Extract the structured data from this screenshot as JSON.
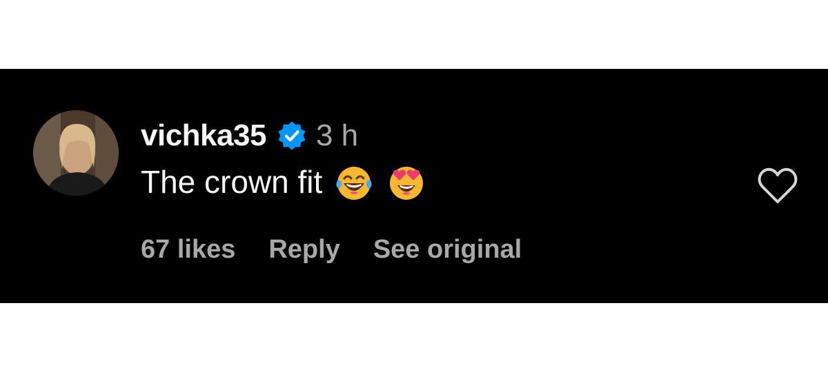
{
  "comment": {
    "username": "vichka35",
    "verified": true,
    "timestamp": "3 h",
    "text": "The crown fit",
    "emojis": [
      "laughing-with-tears-emoji",
      "heart-eyes-emoji"
    ]
  },
  "actions": {
    "likes_label": "67 likes",
    "reply_label": "Reply",
    "see_original_label": "See original"
  },
  "icons": {
    "verified": "verified-badge-icon",
    "like": "heart-outline-icon"
  },
  "colors": {
    "background": "#000000",
    "primary_text": "#f5f5f5",
    "secondary_text": "#a8a8a8",
    "verified_blue": "#0095f6"
  }
}
